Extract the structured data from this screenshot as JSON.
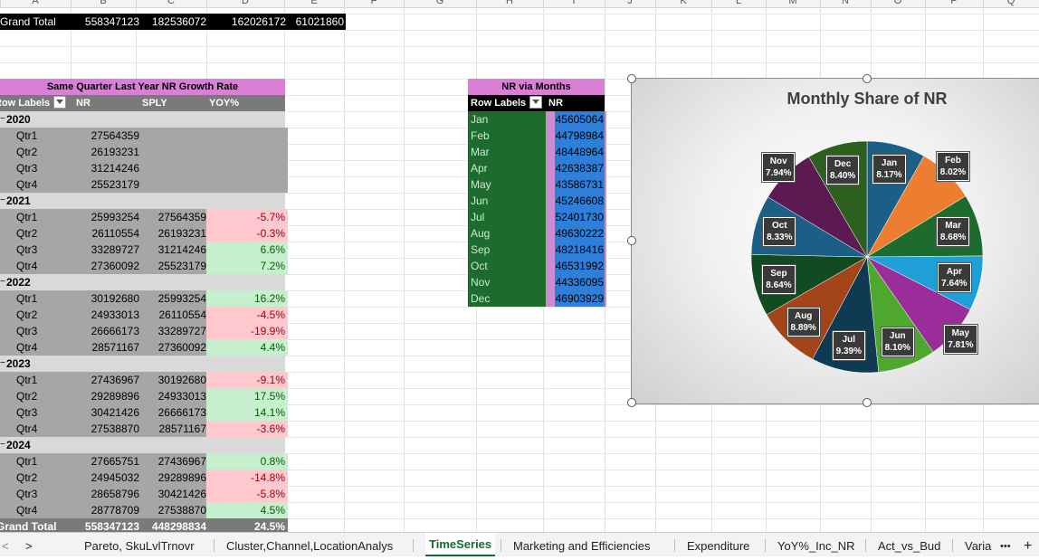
{
  "columns": [
    "A",
    "B",
    "C",
    "D",
    "E",
    "F",
    "G",
    "H",
    "I",
    "J",
    "K",
    "L",
    "M",
    "N",
    "O",
    "P",
    "Q"
  ],
  "grand_total_top": {
    "label": "Grand Total",
    "values": [
      "558347123",
      "182536072",
      "162026172",
      "61021860"
    ]
  },
  "pivot_yoy": {
    "title": "Same Quarter Last Year NR Growth Rate",
    "headers": {
      "row_labels": "Row Labels",
      "nr": "NR",
      "sply": "SPLY",
      "yoy": "YOY%"
    },
    "rows": [
      {
        "type": "year",
        "label": "2020"
      },
      {
        "type": "q",
        "label": "Qtr1",
        "nr": "27564359",
        "sply": "",
        "yoy": ""
      },
      {
        "type": "q",
        "label": "Qtr2",
        "nr": "26193231",
        "sply": "",
        "yoy": ""
      },
      {
        "type": "q",
        "label": "Qtr3",
        "nr": "31214246",
        "sply": "",
        "yoy": ""
      },
      {
        "type": "q",
        "label": "Qtr4",
        "nr": "25523179",
        "sply": "",
        "yoy": ""
      },
      {
        "type": "year",
        "label": "2021"
      },
      {
        "type": "q",
        "label": "Qtr1",
        "nr": "25993254",
        "sply": "27564359",
        "yoy": "-5.7%",
        "sign": "neg"
      },
      {
        "type": "q",
        "label": "Qtr2",
        "nr": "26110554",
        "sply": "26193231",
        "yoy": "-0.3%",
        "sign": "neg"
      },
      {
        "type": "q",
        "label": "Qtr3",
        "nr": "33289727",
        "sply": "31214246",
        "yoy": "6.6%",
        "sign": "pos"
      },
      {
        "type": "q",
        "label": "Qtr4",
        "nr": "27360092",
        "sply": "25523179",
        "yoy": "7.2%",
        "sign": "pos"
      },
      {
        "type": "year",
        "label": "2022"
      },
      {
        "type": "q",
        "label": "Qtr1",
        "nr": "30192680",
        "sply": "25993254",
        "yoy": "16.2%",
        "sign": "pos"
      },
      {
        "type": "q",
        "label": "Qtr2",
        "nr": "24933013",
        "sply": "26110554",
        "yoy": "-4.5%",
        "sign": "neg"
      },
      {
        "type": "q",
        "label": "Qtr3",
        "nr": "26666173",
        "sply": "33289727",
        "yoy": "-19.9%",
        "sign": "neg"
      },
      {
        "type": "q",
        "label": "Qtr4",
        "nr": "28571167",
        "sply": "27360092",
        "yoy": "4.4%",
        "sign": "pos"
      },
      {
        "type": "year",
        "label": "2023"
      },
      {
        "type": "q",
        "label": "Qtr1",
        "nr": "27436967",
        "sply": "30192680",
        "yoy": "-9.1%",
        "sign": "neg"
      },
      {
        "type": "q",
        "label": "Qtr2",
        "nr": "29289896",
        "sply": "24933013",
        "yoy": "17.5%",
        "sign": "pos"
      },
      {
        "type": "q",
        "label": "Qtr3",
        "nr": "30421426",
        "sply": "26666173",
        "yoy": "14.1%",
        "sign": "pos"
      },
      {
        "type": "q",
        "label": "Qtr4",
        "nr": "27538870",
        "sply": "28571167",
        "yoy": "-3.6%",
        "sign": "neg"
      },
      {
        "type": "year",
        "label": "2024"
      },
      {
        "type": "q",
        "label": "Qtr1",
        "nr": "27665751",
        "sply": "27436967",
        "yoy": "0.8%",
        "sign": "pos"
      },
      {
        "type": "q",
        "label": "Qtr2",
        "nr": "24945032",
        "sply": "29289896",
        "yoy": "-14.8%",
        "sign": "neg"
      },
      {
        "type": "q",
        "label": "Qtr3",
        "nr": "28658796",
        "sply": "30421426",
        "yoy": "-5.8%",
        "sign": "neg"
      },
      {
        "type": "q",
        "label": "Qtr4",
        "nr": "28778709",
        "sply": "27538870",
        "yoy": "4.5%",
        "sign": "pos"
      },
      {
        "type": "gt",
        "label": "Grand Total",
        "nr": "558347123",
        "sply": "448298834",
        "yoy": "24.5%"
      }
    ]
  },
  "pivot_months": {
    "title": "NR via Months",
    "headers": {
      "row_labels": "Row Labels",
      "nr": "NR"
    },
    "rows": [
      {
        "month": "Jan",
        "nr": "45605064"
      },
      {
        "month": "Feb",
        "nr": "44798984"
      },
      {
        "month": "Mar",
        "nr": "48448964"
      },
      {
        "month": "Apr",
        "nr": "42638387"
      },
      {
        "month": "May",
        "nr": "43586731"
      },
      {
        "month": "Jun",
        "nr": "45246608"
      },
      {
        "month": "Jul",
        "nr": "52401730"
      },
      {
        "month": "Aug",
        "nr": "49630222"
      },
      {
        "month": "Sep",
        "nr": "48218416"
      },
      {
        "month": "Oct",
        "nr": "46531992"
      },
      {
        "month": "Nov",
        "nr": "44336095"
      },
      {
        "month": "Dec",
        "nr": "46903929"
      }
    ]
  },
  "chart_data": {
    "type": "pie",
    "title": "Monthly Share of NR",
    "categories": [
      "Jan",
      "Feb",
      "Mar",
      "Apr",
      "May",
      "Jun",
      "Jul",
      "Aug",
      "Sep",
      "Oct",
      "Nov",
      "Dec"
    ],
    "values": [
      8.17,
      8.02,
      8.68,
      7.64,
      7.81,
      8.1,
      9.39,
      8.89,
      8.64,
      8.33,
      7.94,
      8.4
    ],
    "labels": [
      "8.17%",
      "8.02%",
      "8.68%",
      "7.64%",
      "7.81%",
      "8.10%",
      "9.39%",
      "8.89%",
      "8.64%",
      "8.33%",
      "7.94%",
      "8.40%"
    ],
    "colors": [
      "#1b5f86",
      "#ed7d31",
      "#1e6b2e",
      "#1f9fd8",
      "#9b2d9b",
      "#4ea72e",
      "#0e3a52",
      "#a3441a",
      "#124a22",
      "#1b5f86",
      "#5b1a52",
      "#2d5f1e"
    ]
  },
  "sheet_tabs": {
    "nav_prev": "<",
    "nav_next": ">",
    "tabs": [
      "Pareto, SkuLvlTrnovr",
      "Cluster,Channel,LocationAnalys",
      "TimeSeries",
      "Marketing and Efficiencies",
      "Expenditure",
      "YoY%_Inc_NR",
      "Act_vs_Bud",
      "Varia"
    ],
    "active": "TimeSeries",
    "more": "•••",
    "add": "+"
  }
}
